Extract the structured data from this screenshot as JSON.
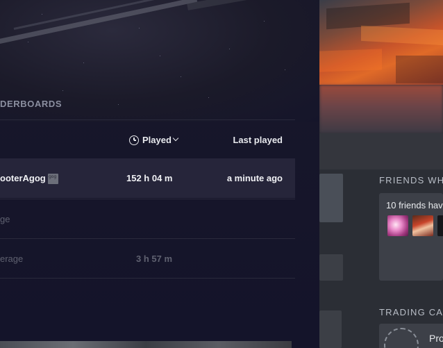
{
  "leaderboard": {
    "section_label": "DERBOARDS",
    "columns": {
      "played": "Played",
      "last_played": "Last played"
    },
    "rows": [
      {
        "name": "ooterAgog",
        "played": "152 h 04 m",
        "last_played": "a minute ago"
      },
      {
        "name": "ge",
        "played": "",
        "last_played": ""
      },
      {
        "name": "erage",
        "played": "3 h 57 m",
        "last_played": ""
      }
    ]
  },
  "friends": {
    "heading": "FRIENDS WH",
    "summary": "10 friends hav"
  },
  "trading": {
    "heading": "TRADING CA",
    "label": "Pro"
  },
  "icons": [
    "clock-icon",
    "chevron-down-icon",
    "gog-icon"
  ]
}
